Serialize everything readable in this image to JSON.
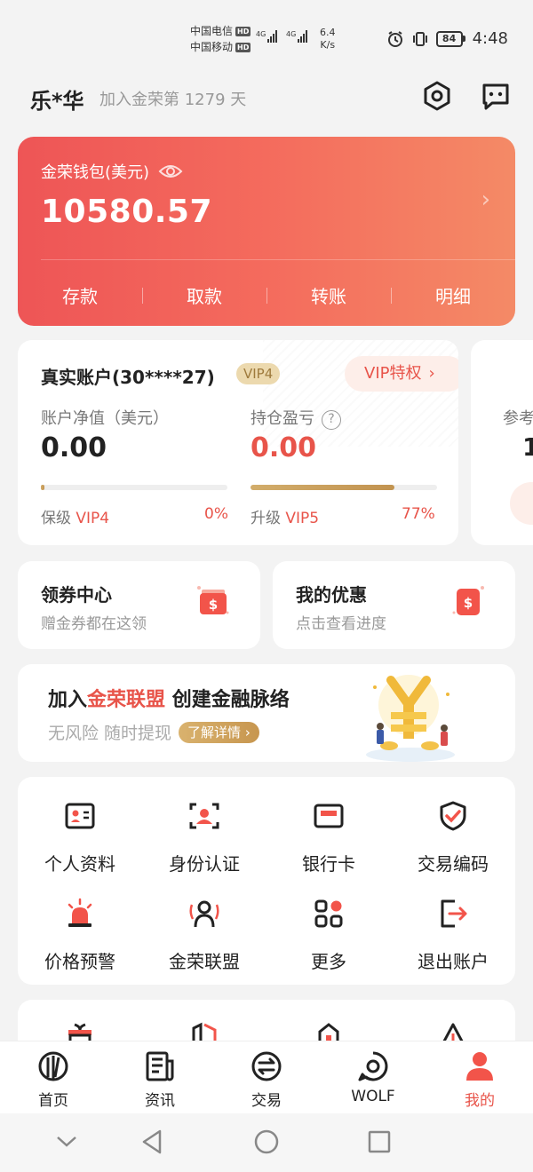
{
  "status_bar": {
    "carrier_1": "中国电信",
    "carrier_2": "中国移动",
    "hd_label": "HD",
    "net_label_1": "4G",
    "net_label_2": "4G",
    "speed_value": "6.4",
    "speed_unit": "K/s",
    "battery": "84",
    "time": "4:48"
  },
  "header": {
    "user_name": "乐*华",
    "join_days": "加入金荣第 1279 天",
    "settings_icon": "hexagon-gear-icon",
    "message_icon": "chat-bubble-icon"
  },
  "wallet": {
    "label": "金荣钱包(美元)",
    "amount": "10580.57",
    "actions": [
      "存款",
      "取款",
      "转账",
      "明细"
    ],
    "colors": {
      "start": "#ee5556",
      "end": "#f48a66"
    }
  },
  "account": {
    "title": "真实账户(30****27)",
    "vip_badge": "VIP4",
    "vip_privilege": "VIP特权",
    "net_value_label": "账户净值（美元）",
    "net_value": "0.00",
    "pnl_label": "持仓盈亏",
    "pnl_value": "0.00",
    "keep_label": "保级",
    "keep_level": "VIP4",
    "keep_pct": "0%",
    "keep_progress": 0.02,
    "upgrade_label": "升级",
    "upgrade_level": "VIP5",
    "upgrade_pct": "77%",
    "upgrade_progress": 0.77
  },
  "peek_card": {
    "label": "参考",
    "value": "1"
  },
  "coupons": {
    "title": "领券中心",
    "subtitle": "赠金券都在这领",
    "icon": "ticket-dollar-icon"
  },
  "offers": {
    "title": "我的优惠",
    "subtitle": "点击查看进度",
    "icon": "dollar-card-icon"
  },
  "alliance": {
    "title_prefix": "加入",
    "title_highlight": "金荣联盟",
    "title_suffix": " 创建金融脉络",
    "subtitle": "无风险 随时提现",
    "learn_more": "了解详情 ›"
  },
  "grid": [
    {
      "label": "个人资料",
      "icon": "id-card-icon"
    },
    {
      "label": "身份认证",
      "icon": "face-scan-icon"
    },
    {
      "label": "银行卡",
      "icon": "bank-card-icon"
    },
    {
      "label": "交易编码",
      "icon": "shield-check-icon"
    },
    {
      "label": "价格预警",
      "icon": "alarm-light-icon"
    },
    {
      "label": "金荣联盟",
      "icon": "people-signal-icon"
    },
    {
      "label": "更多",
      "icon": "grid-more-icon"
    },
    {
      "label": "退出账户",
      "icon": "logout-icon"
    }
  ],
  "bottom_nav": [
    {
      "label": "首页",
      "icon": "home-logo-icon",
      "active": false
    },
    {
      "label": "资讯",
      "icon": "news-icon",
      "active": false
    },
    {
      "label": "交易",
      "icon": "exchange-icon",
      "active": false
    },
    {
      "label": "WOLF",
      "icon": "chat-ring-icon",
      "active": false
    },
    {
      "label": "我的",
      "icon": "profile-icon",
      "active": true
    }
  ],
  "accent_color": "#e8544a",
  "gold_color": "#c7964f"
}
